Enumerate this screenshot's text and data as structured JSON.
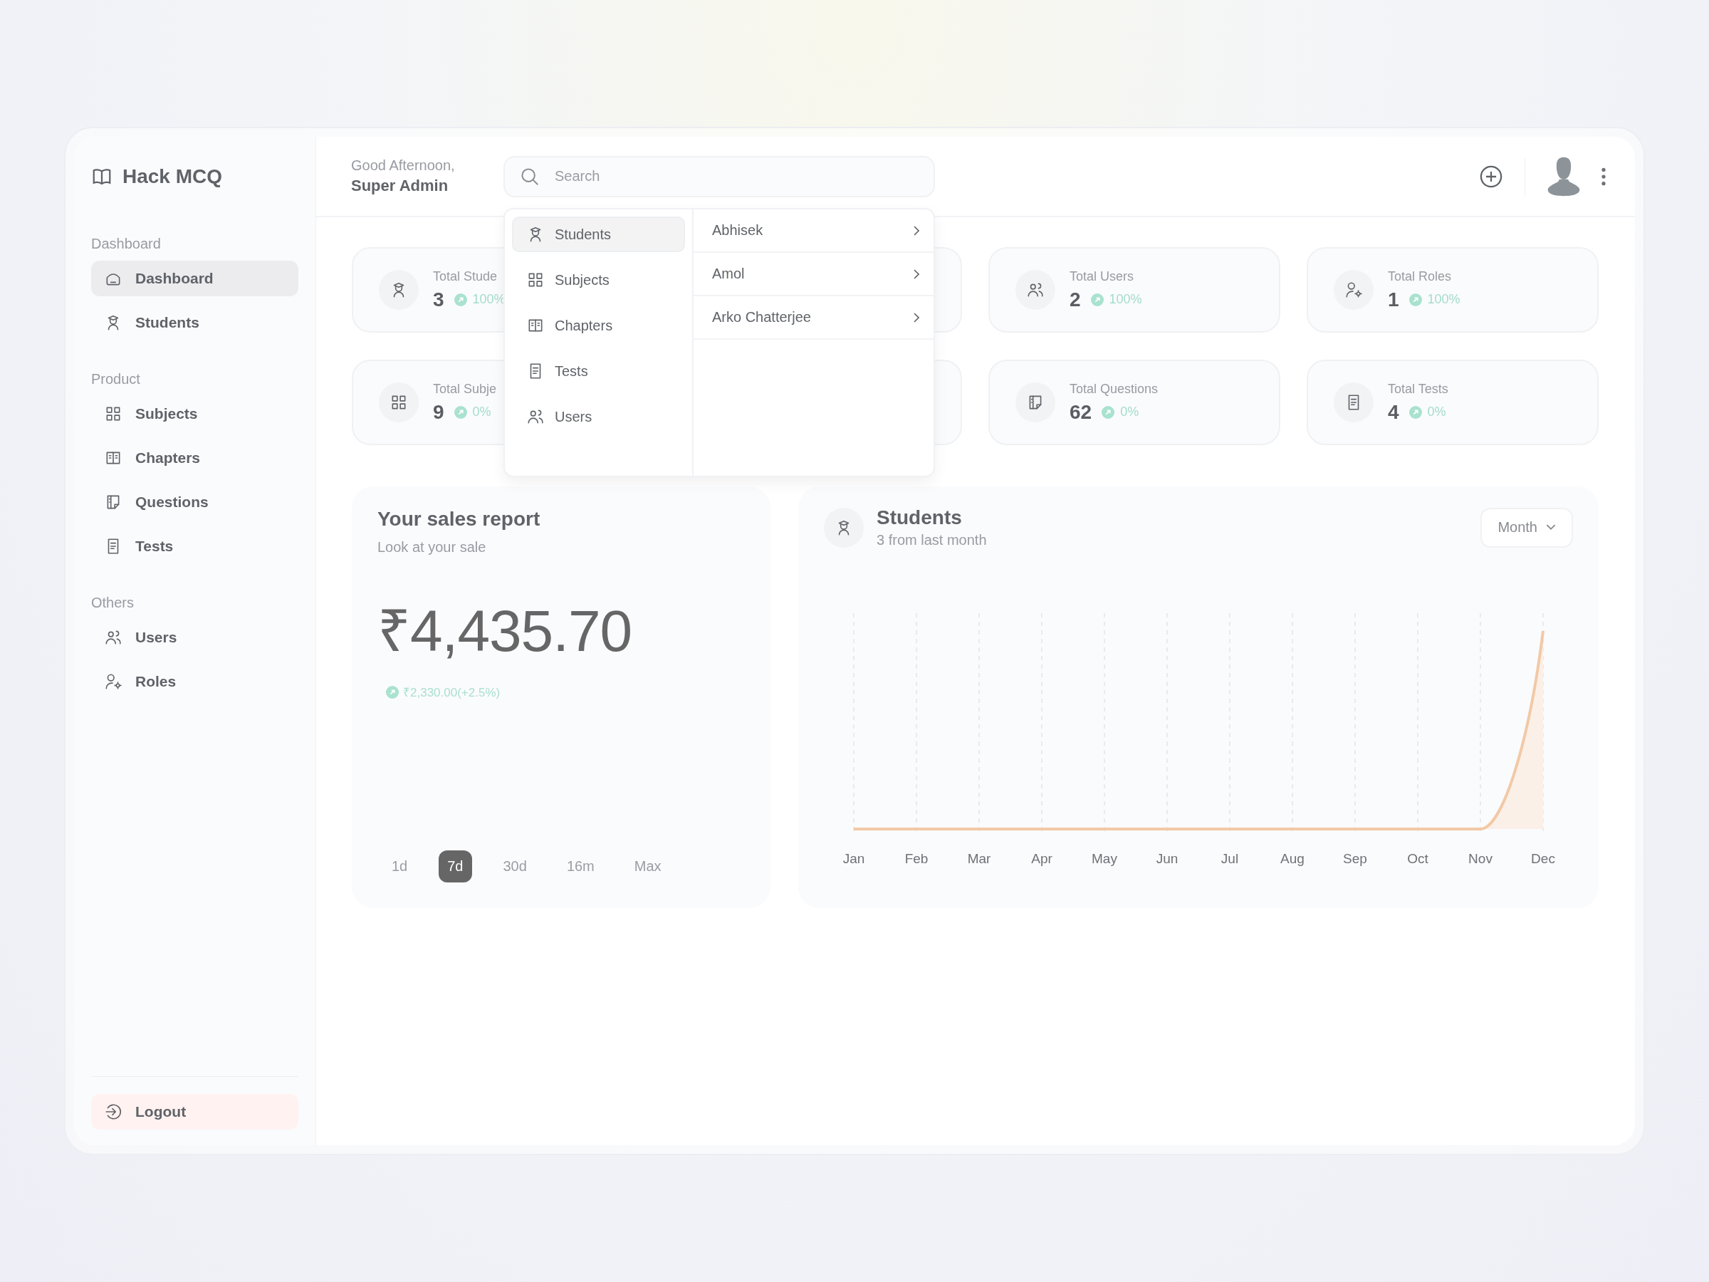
{
  "brand": {
    "name": "Hack MCQ"
  },
  "sidebar": {
    "sections": [
      {
        "label": "Dashboard",
        "items": [
          {
            "label": "Dashboard",
            "kind": "dashboard",
            "selected": true
          },
          {
            "label": "Students",
            "kind": "students",
            "selected": false
          }
        ]
      },
      {
        "label": "Product",
        "items": [
          {
            "label": "Subjects",
            "kind": "subjects",
            "selected": false
          },
          {
            "label": "Chapters",
            "kind": "chapters",
            "selected": false
          },
          {
            "label": "Questions",
            "kind": "questions",
            "selected": false
          },
          {
            "label": "Tests",
            "kind": "tests",
            "selected": false
          }
        ]
      },
      {
        "label": "Others",
        "items": [
          {
            "label": "Users",
            "kind": "users",
            "selected": false
          },
          {
            "label": "Roles",
            "kind": "roles",
            "selected": false
          }
        ]
      }
    ],
    "logout": {
      "label": "Logout"
    }
  },
  "header": {
    "greeting": "Good Afternoon,",
    "name": "Super Admin"
  },
  "search": {
    "placeholder": "Search"
  },
  "search_dropdown": {
    "categories": [
      {
        "label": "Students",
        "kind": "students",
        "selected": true
      },
      {
        "label": "Subjects",
        "kind": "subjects",
        "selected": false
      },
      {
        "label": "Chapters",
        "kind": "chapters",
        "selected": false
      },
      {
        "label": "Tests",
        "kind": "tests",
        "selected": false
      },
      {
        "label": "Users",
        "kind": "users",
        "selected": false
      }
    ],
    "results": [
      {
        "label": "Abhisek"
      },
      {
        "label": "Amol"
      },
      {
        "label": "Arko Chatterjee"
      }
    ]
  },
  "stats": [
    {
      "kind": "students",
      "title": "Total Stude",
      "value": "3",
      "change": "100%"
    },
    {
      "kind": "covered"
    },
    {
      "kind": "users",
      "title": "Total Users",
      "value": "2",
      "change": "100%"
    },
    {
      "kind": "roles",
      "title": "Total Roles",
      "value": "1",
      "change": "100%"
    },
    {
      "kind": "subjects",
      "title": "Total Subje",
      "value": "9",
      "change": "0%"
    },
    {
      "kind": "covered"
    },
    {
      "kind": "questions",
      "title": "Total Questions",
      "value": "62",
      "change": "0%"
    },
    {
      "kind": "tests",
      "title": "Total Tests",
      "value": "4",
      "change": "0%"
    }
  ],
  "sales": {
    "title": "Your sales report",
    "subtitle": "Look at your sale",
    "amount": "₹4,435.70",
    "change": "₹2,330.00(+2.5%)",
    "periods": [
      {
        "label": "1d",
        "selected": false
      },
      {
        "label": "7d",
        "selected": true
      },
      {
        "label": "30d",
        "selected": false
      },
      {
        "label": "16m",
        "selected": false
      },
      {
        "label": "Max",
        "selected": false
      }
    ]
  },
  "students_chart": {
    "title": "Students",
    "subtitle": "3 from last month",
    "filter": "Month",
    "months": [
      "Jan",
      "Feb",
      "Mar",
      "Apr",
      "May",
      "Jun",
      "Jul",
      "Aug",
      "Sep",
      "Oct",
      "Nov",
      "Dec"
    ]
  }
}
